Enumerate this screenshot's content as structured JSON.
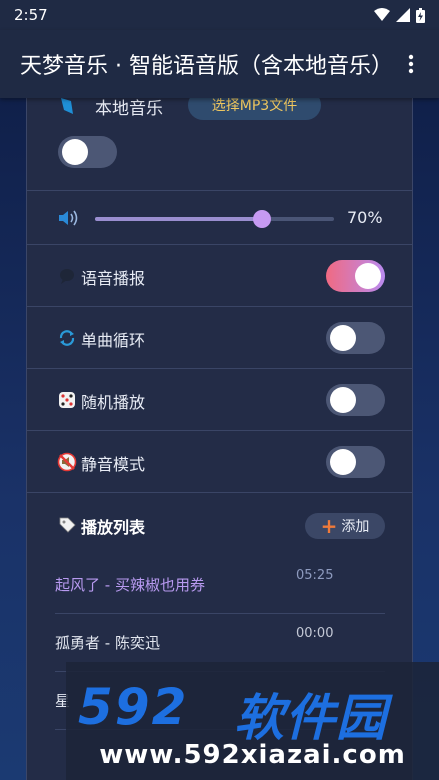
{
  "status_bar": {
    "time": "2:57"
  },
  "app_bar": {
    "title": "天梦音乐 · 智能语音版（含本地音乐）"
  },
  "local_music": {
    "label": "本地音乐",
    "choose_button": "选择MP3文件",
    "enabled": false
  },
  "volume": {
    "value_text": "70%",
    "level": 0.7
  },
  "settings": [
    {
      "label": "语音播报",
      "icon": "speech-bubble-icon",
      "on": true
    },
    {
      "label": "单曲循环",
      "icon": "repeat-icon",
      "on": false
    },
    {
      "label": "随机播放",
      "icon": "dice-icon",
      "on": false
    },
    {
      "label": "静音模式",
      "icon": "mute-icon",
      "on": false
    }
  ],
  "playlist": {
    "title": "播放列表",
    "add_button": "添加",
    "songs": [
      {
        "title": "起风了 - 买辣椒也用券",
        "time": "05:25",
        "active": true
      },
      {
        "title": "孤勇者 - 陈奕迅",
        "time": "00:00",
        "active": false
      },
      {
        "title": "星",
        "time": "",
        "active": false
      }
    ]
  },
  "watermark": {
    "logo_num": "592",
    "logo_cn": "软件园",
    "url": "www.592xiazai.com"
  },
  "colors": {
    "accent_purple": "#b89af0",
    "toggle_on_start": "#f06a82",
    "toggle_on_end": "#b98bf0",
    "button_gold": "#f0c860"
  }
}
